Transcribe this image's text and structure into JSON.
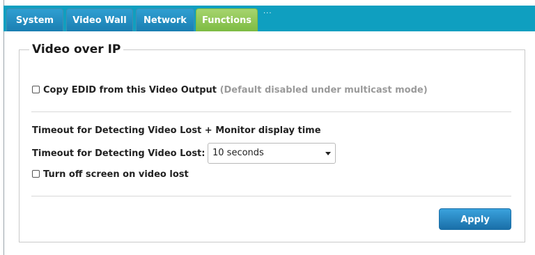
{
  "tabs": [
    {
      "label": "System"
    },
    {
      "label": "Video Wall"
    },
    {
      "label": "Network"
    },
    {
      "label": "Functions"
    }
  ],
  "tab_accent_colors": {
    "tabbar": "#0f9fc0",
    "tab": "#1f86bd",
    "active_tab": "#8cc34f"
  },
  "section": {
    "title": "Video over IP",
    "copy_edid": {
      "label": "Copy EDID from this Video Output",
      "note": "(Default disabled under multicast mode)",
      "checked": false
    },
    "timeout_heading": "Timeout for Detecting Video Lost + Monitor display time",
    "timeout_label": "Timeout for Detecting Video Lost:",
    "timeout_value": "10 seconds",
    "turn_off": {
      "label": "Turn off screen on video lost",
      "checked": false
    },
    "apply_label": "Apply"
  }
}
